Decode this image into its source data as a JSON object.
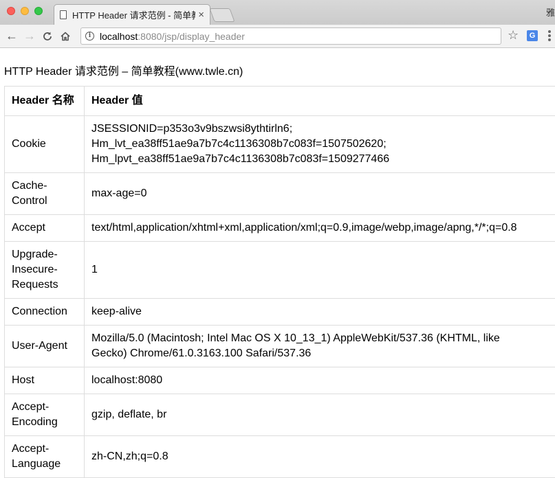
{
  "browser": {
    "tab_title": "HTTP Header 请求范例 - 简单教程",
    "tab_close": "×",
    "profile_char": "雅",
    "url_host": "localhost",
    "url_rest": ":8080/jsp/display_header",
    "translate_icon_text": "G"
  },
  "page": {
    "title": "HTTP Header 请求范例 – 简单教程(www.twle.cn)",
    "table": {
      "columns": [
        "Header 名称",
        "Header 值"
      ],
      "rows": [
        {
          "name": "Cookie",
          "value": [
            "JSESSIONID=p353o3v9bszwsi8ythtirln6;",
            "Hm_lvt_ea38ff51ae9a7b7c4c1136308b7c083f=1507502620;",
            "Hm_lpvt_ea38ff51ae9a7b7c4c1136308b7c083f=1509277466"
          ]
        },
        {
          "name": "Cache-Control",
          "value": [
            "max-age=0"
          ]
        },
        {
          "name": "Accept",
          "value": [
            "text/html,application/xhtml+xml,application/xml;q=0.9,image/webp,image/apng,*/*;q=0.8"
          ]
        },
        {
          "name": "Upgrade-Insecure-Requests",
          "value": [
            "1"
          ]
        },
        {
          "name": "Connection",
          "value": [
            "keep-alive"
          ]
        },
        {
          "name": "User-Agent",
          "value": [
            "Mozilla/5.0 (Macintosh; Intel Mac OS X 10_13_1) AppleWebKit/537.36 (KHTML, like",
            "Gecko) Chrome/61.0.3163.100 Safari/537.36"
          ]
        },
        {
          "name": "Host",
          "value": [
            "localhost:8080"
          ]
        },
        {
          "name": "Accept-Encoding",
          "value": [
            "gzip, deflate, br"
          ]
        },
        {
          "name": "Accept-Language",
          "value": [
            "zh-CN,zh;q=0.8"
          ]
        }
      ]
    }
  }
}
